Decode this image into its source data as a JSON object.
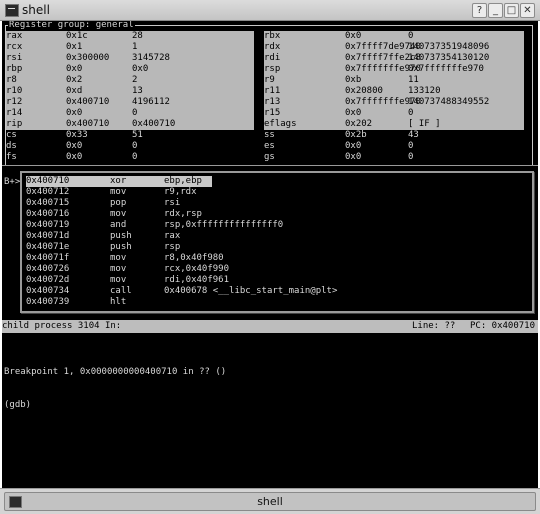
{
  "window": {
    "title": "shell",
    "buttons": {
      "help": "?",
      "minimize": "_",
      "maximize": "□",
      "close": "✕"
    }
  },
  "registers": {
    "group_label": "Register group: general",
    "rows": [
      {
        "left": [
          "rax",
          "0x1c",
          "28"
        ],
        "right": [
          "rbx",
          "0x0",
          "0"
        ]
      },
      {
        "left": [
          "rcx",
          "0x1",
          "1"
        ],
        "right": [
          "rdx",
          "0x7ffff7de9740",
          "140737351948096"
        ]
      },
      {
        "left": [
          "rsi",
          "0x300000",
          "3145728"
        ],
        "right": [
          "rdi",
          "0x7ffff7ffe2c8",
          "140737354130120"
        ]
      },
      {
        "left": [
          "rbp",
          "0x0",
          "0x0"
        ],
        "right": [
          "rsp",
          "0x7fffffffe970",
          "0x7fffffffe970"
        ]
      },
      {
        "left": [
          "r8",
          "0x2",
          "2"
        ],
        "right": [
          "r9",
          "0xb",
          "11"
        ]
      },
      {
        "left": [
          "r10",
          "0xd",
          "13"
        ],
        "right": [
          "r11",
          "0x20800",
          "133120"
        ]
      },
      {
        "left": [
          "r12",
          "0x400710",
          "4196112"
        ],
        "right": [
          "r13",
          "0x7fffffffe970",
          "140737488349552"
        ]
      },
      {
        "left": [
          "r14",
          "0x0",
          "0"
        ],
        "right": [
          "r15",
          "0x0",
          "0"
        ]
      },
      {
        "left": [
          "rip",
          "0x400710",
          "0x400710"
        ],
        "right": [
          "eflags",
          "0x202",
          "[ IF ]"
        ]
      },
      {
        "left": [
          "cs",
          "0x33",
          "51"
        ],
        "right": [
          "ss",
          "0x2b",
          "43"
        ]
      },
      {
        "left": [
          "ds",
          "0x0",
          "0"
        ],
        "right": [
          "es",
          "0x0",
          "0"
        ]
      },
      {
        "left": [
          "fs",
          "0x0",
          "0"
        ],
        "right": [
          "gs",
          "0x0",
          "0"
        ]
      }
    ]
  },
  "breakpoint_marker": "B+>",
  "asm": [
    [
      "0x400710",
      "xor",
      "ebp,ebp"
    ],
    [
      "0x400712",
      "mov",
      "r9,rdx"
    ],
    [
      "0x400715",
      "pop",
      "rsi"
    ],
    [
      "0x400716",
      "mov",
      "rdx,rsp"
    ],
    [
      "0x400719",
      "and",
      "rsp,0xfffffffffffffff0"
    ],
    [
      "0x40071d",
      "push",
      "rax"
    ],
    [
      "0x40071e",
      "push",
      "rsp"
    ],
    [
      "0x40071f",
      "mov",
      "r8,0x40f980"
    ],
    [
      "0x400726",
      "mov",
      "rcx,0x40f990"
    ],
    [
      "0x40072d",
      "mov",
      "rdi,0x40f961"
    ],
    [
      "0x400734",
      "call",
      "0x400678 <__libc_start_main@plt>"
    ],
    [
      "0x400739",
      "hlt",
      ""
    ]
  ],
  "status": {
    "process": "child process 3104 In:",
    "line": "Line: ??",
    "pc": "PC: 0x400710"
  },
  "console": [
    "Breakpoint 1, 0x0000000000400710 in ?? ()",
    "(gdb)"
  ],
  "taskbar": {
    "item_label": "shell"
  }
}
